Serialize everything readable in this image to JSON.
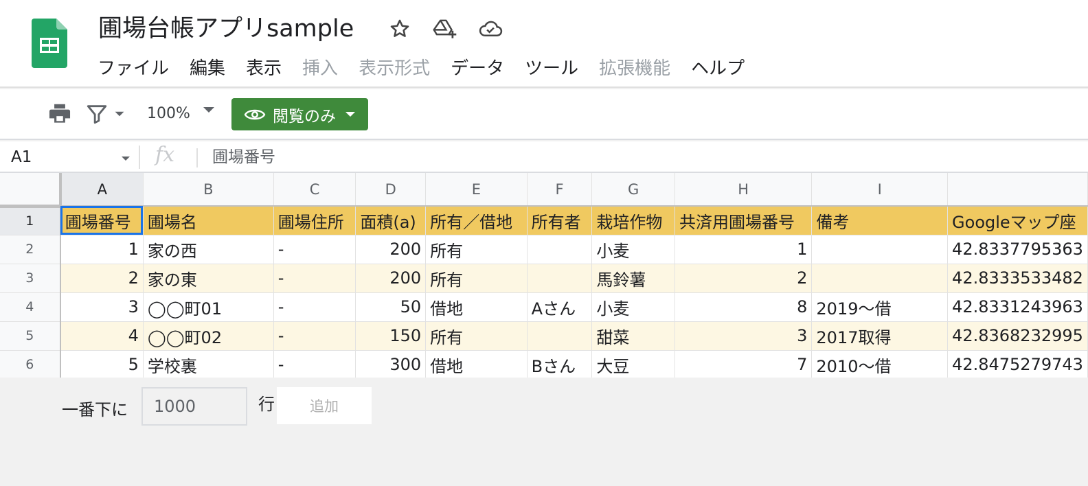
{
  "doc": {
    "title": "圃場台帳アプリsample"
  },
  "icons": {
    "star": "star-icon",
    "drive": "drive-add-icon",
    "cloud": "cloud-saved-icon"
  },
  "menu": [
    {
      "label": "ファイル",
      "disabled": false
    },
    {
      "label": "編集",
      "disabled": false
    },
    {
      "label": "表示",
      "disabled": false
    },
    {
      "label": "挿入",
      "disabled": true
    },
    {
      "label": "表示形式",
      "disabled": true
    },
    {
      "label": "データ",
      "disabled": false
    },
    {
      "label": "ツール",
      "disabled": false
    },
    {
      "label": "拡張機能",
      "disabled": true
    },
    {
      "label": "ヘルプ",
      "disabled": false
    }
  ],
  "toolbar": {
    "zoom": "100%",
    "view_label": "閲覧のみ"
  },
  "formula": {
    "cell_ref": "A1",
    "fx": "fx",
    "content": "圃場番号"
  },
  "sheet": {
    "columns": [
      "A",
      "B",
      "C",
      "D",
      "E",
      "F",
      "G",
      "H",
      "I",
      ""
    ],
    "header": [
      "圃場番号",
      "圃場名",
      "圃場住所",
      "面積(a)",
      "所有／借地",
      "所有者",
      "栽培作物",
      "共済用圃場番号",
      "備考",
      "Googleマップ座"
    ],
    "rows": [
      {
        "num": "2",
        "cells": [
          "1",
          "家の西",
          "-",
          "200",
          "所有",
          "",
          "小麦",
          "1",
          "",
          "42.8337795363"
        ]
      },
      {
        "num": "3",
        "cells": [
          "2",
          "家の東",
          "-",
          "200",
          "所有",
          "",
          "馬鈴薯",
          "2",
          "",
          "42.8333533482"
        ]
      },
      {
        "num": "4",
        "cells": [
          "3",
          "◯◯町01",
          "-",
          "50",
          "借地",
          "Aさん",
          "小麦",
          "8",
          "2019〜借",
          "42.8331243963"
        ]
      },
      {
        "num": "5",
        "cells": [
          "4",
          "◯◯町02",
          "-",
          "150",
          "所有",
          "",
          "甜菜",
          "3",
          "2017取得",
          "42.8368232995"
        ]
      },
      {
        "num": "6",
        "cells": [
          "5",
          "学校裏",
          "-",
          "300",
          "借地",
          "Bさん",
          "大豆",
          "7",
          "2010〜借",
          "42.8475279743"
        ]
      }
    ]
  },
  "add_rows": {
    "prefix": "一番下に",
    "count": "1000",
    "unit": "行",
    "button": "追加"
  }
}
